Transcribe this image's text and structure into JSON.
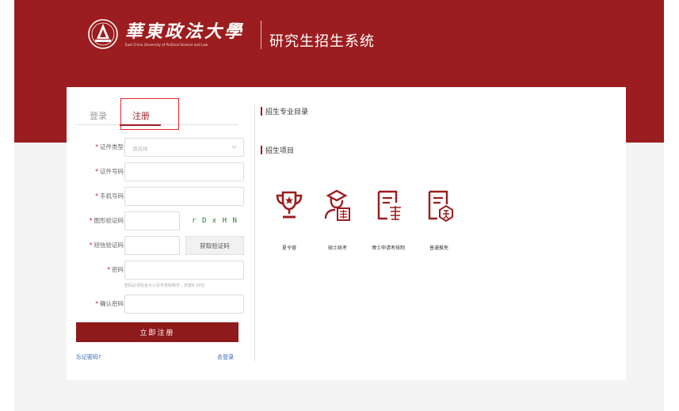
{
  "header": {
    "university_cn": "華東政法大學",
    "university_en": "East China University of Political Science and Law",
    "system_title": "研究生招生系统"
  },
  "tabs": {
    "login": "登录",
    "register": "注册"
  },
  "form": {
    "id_type": {
      "label": "证件类型",
      "placeholder": "请选择"
    },
    "id_number": {
      "label": "证件号码"
    },
    "phone": {
      "label": "手机号码"
    },
    "captcha": {
      "label": "图形验证码",
      "code": "r D x H N"
    },
    "sms": {
      "label": "短信验证码",
      "button": "获取验证码"
    },
    "password": {
      "label": "密码",
      "hint": "密码必须包含大小写字母和数字，长度8-20位"
    },
    "confirm_password": {
      "label": "确认密码"
    },
    "required_mark": "*",
    "submit": "立即注册",
    "forgot": "忘记密码?",
    "go_login": "去登录"
  },
  "right": {
    "catalog_title": "招生专业目录",
    "projects_title": "招生项目",
    "items": [
      {
        "label": "夏令营",
        "icon": "trophy-icon"
      },
      {
        "label": "硕士统考",
        "icon": "master-exam-icon"
      },
      {
        "label": "博士申请考核制",
        "icon": "doctoral-application-icon"
      },
      {
        "label": "普通推免",
        "icon": "recommendation-exemption-icon"
      }
    ]
  },
  "colors": {
    "brand": "#9c1d1f",
    "highlight": "#e8272b",
    "link": "#2f65b0"
  }
}
